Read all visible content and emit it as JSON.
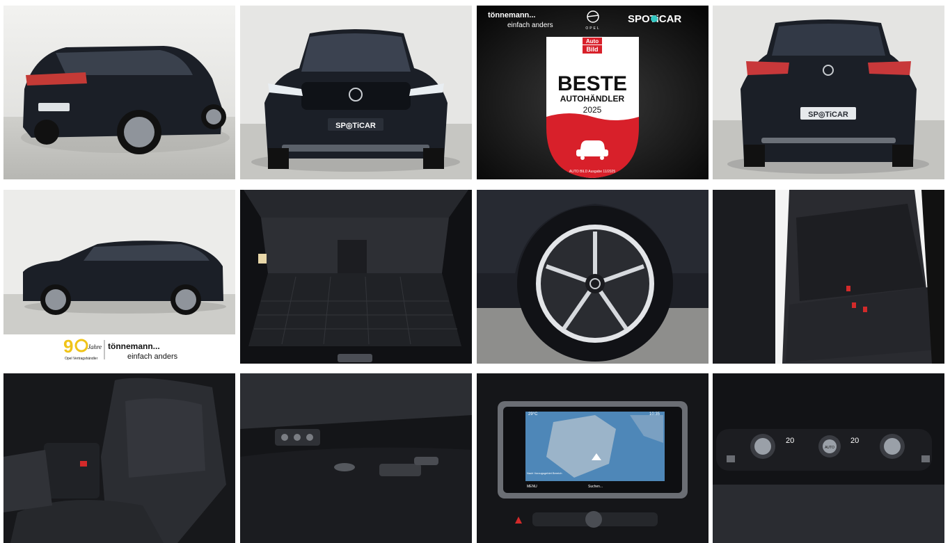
{
  "gallery": {
    "photos": [
      {
        "subject": "rear-three-quarter",
        "plate": "SP◎TiCAR"
      },
      {
        "subject": "front",
        "plate": "SP◎TiCAR"
      },
      {
        "subject": "award-banner"
      },
      {
        "subject": "rear",
        "plate": "SP◎TiCAR"
      },
      {
        "subject": "side"
      },
      {
        "subject": "trunk"
      },
      {
        "subject": "wheel"
      },
      {
        "subject": "rear-seats"
      },
      {
        "subject": "front-seat"
      },
      {
        "subject": "seat-controls"
      },
      {
        "subject": "infotainment"
      },
      {
        "subject": "climate-controls"
      }
    ]
  },
  "award": {
    "dealer_line1": "tönnemann...",
    "dealer_line2": "einfach anders",
    "brand": "OPEL",
    "spoticar": "SPOTiCAR",
    "magazine_top": "Auto",
    "magazine_bottom": "Bild",
    "headline": "BESTE",
    "subheadline": "AUTOHÄNDLER",
    "year": "2025",
    "footnote": "AUTO BILD Ausgabe 11/2025"
  },
  "side_banner": {
    "anniversary_digit": "9",
    "anniversary_word": "Jahre",
    "partner_label": "Opel Vertragshändler",
    "dealer_line1": "tönnemann...",
    "dealer_line2": "einfach anders"
  },
  "screen": {
    "temp": "29°C",
    "time": "10:35",
    "menu": "MENU",
    "search": "Suchen...",
    "destination": "Nach Vorzugsgebiet Bereich"
  },
  "climate": {
    "left_temp": "20",
    "right_temp": "20",
    "auto_label": "AUTO"
  },
  "colors": {
    "car_body": "#1b1f27",
    "studio_wall": "#e8e8e6",
    "studio_floor": "#c9c9c6",
    "award_red": "#d8202a",
    "spoticar_teal": "#34c6c1"
  }
}
